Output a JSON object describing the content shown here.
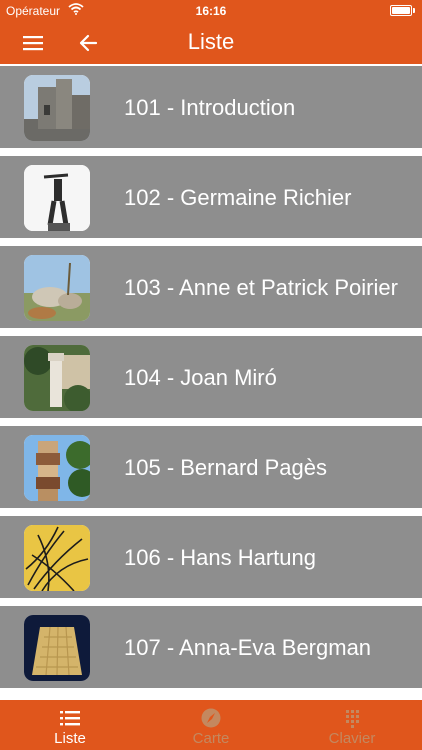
{
  "status_bar": {
    "carrier": "Opérateur",
    "time": "16:16"
  },
  "nav": {
    "title": "Liste"
  },
  "items": [
    {
      "label": "101 - Introduction"
    },
    {
      "label": "102 - Germaine Richier"
    },
    {
      "label": "103 - Anne et Patrick Poirier"
    },
    {
      "label": "104 - Joan Miró"
    },
    {
      "label": "105 - Bernard Pagès"
    },
    {
      "label": "106 - Hans Hartung"
    },
    {
      "label": "107 - Anna-Eva Bergman"
    }
  ],
  "tabs": [
    {
      "label": "Liste",
      "icon": "list-icon",
      "active": true
    },
    {
      "label": "Carte",
      "icon": "compass-icon",
      "active": false
    },
    {
      "label": "Clavier",
      "icon": "keypad-icon",
      "active": false
    }
  ],
  "colors": {
    "accent": "#e0561c",
    "row_bg": "#8e8e8e",
    "inactive_tab": "#c4885f"
  }
}
